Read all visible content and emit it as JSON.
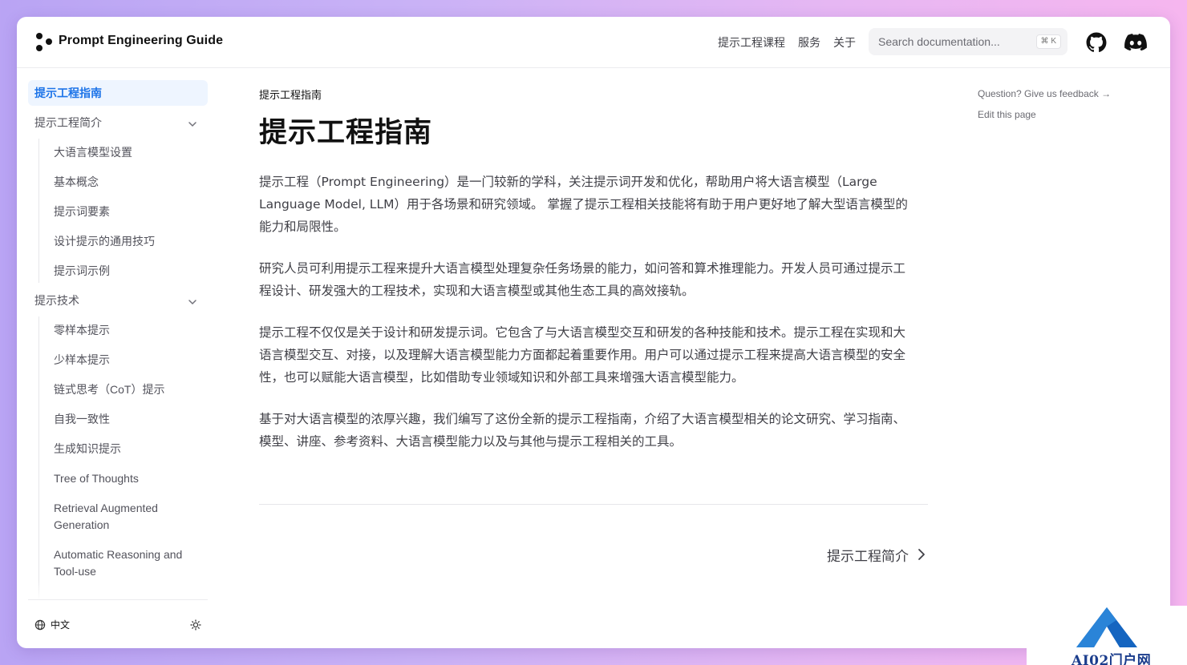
{
  "header": {
    "site_title": "Prompt Engineering Guide",
    "nav": [
      {
        "label": "提示工程课程"
      },
      {
        "label": "服务"
      },
      {
        "label": "关于"
      }
    ],
    "search": {
      "placeholder": "Search documentation...",
      "shortcut": "⌘ K"
    },
    "icons": [
      "github-icon",
      "discord-icon"
    ]
  },
  "sidebar": {
    "items": [
      {
        "label": "提示工程指南",
        "active": true,
        "level": 0
      },
      {
        "label": "提示工程简介",
        "level": 0,
        "expandable": true
      },
      {
        "label": "大语言模型设置",
        "level": 1
      },
      {
        "label": "基本概念",
        "level": 1
      },
      {
        "label": "提示词要素",
        "level": 1
      },
      {
        "label": "设计提示的通用技巧",
        "level": 1
      },
      {
        "label": "提示词示例",
        "level": 1
      },
      {
        "label": "提示技术",
        "level": 0,
        "expandable": true
      },
      {
        "label": "零样本提示",
        "level": 1
      },
      {
        "label": "少样本提示",
        "level": 1
      },
      {
        "label": "链式思考（CoT）提示",
        "level": 1
      },
      {
        "label": "自我一致性",
        "level": 1
      },
      {
        "label": "生成知识提示",
        "level": 1
      },
      {
        "label": "Tree of Thoughts",
        "level": 1
      },
      {
        "label": "Retrieval Augmented Generation",
        "level": 1,
        "lines": [
          "Retrieval Augmented",
          "Generation"
        ]
      },
      {
        "label": "Automatic Reasoning and Tool-use",
        "level": 1,
        "lines": [
          "Automatic Reasoning and",
          "Tool-use"
        ]
      }
    ],
    "footer": {
      "language": "中文",
      "theme_icon": "sun-icon"
    }
  },
  "main": {
    "breadcrumb": "提示工程指南",
    "title": "提示工程指南",
    "paragraphs": [
      [
        "提示工程（Prompt Engineering）是一门较新的学科，关注提示词开发和优化，帮助用户将大语言模型（Large",
        "Language Model, LLM）用于各场景和研究领域。 掌握了提示工程相关技能将有助于用户更好地了解大型语言模型的",
        "能力和局限性。"
      ],
      [
        "研究人员可利用提示工程来提升大语言模型处理复杂任务场景的能力，如问答和算术推理能力。开发人员可通过提示工",
        "程设计、研发强大的工程技术，实现和大语言模型或其他生态工具的高效接轨。"
      ],
      [
        "提示工程不仅仅是关于设计和研发提示词。它包含了与大语言模型交互和研发的各种技能和技术。提示工程在实现和大",
        "语言模型交互、对接，以及理解大语言模型能力方面都起着重要作用。用户可以通过提示工程来提高大语言模型的安全",
        "性，也可以赋能大语言模型，比如借助专业领域知识和外部工具来增强大语言模型能力。"
      ],
      [
        "基于对大语言模型的浓厚兴趣，我们编写了这份全新的提示工程指南，介绍了大语言模型相关的论文研究、学习指南、",
        "模型、讲座、参考资料、大语言模型能力以及与其他与提示工程相关的工具。"
      ]
    ],
    "next_link": "提示工程简介"
  },
  "toc": {
    "feedback": "Question? Give us feedback →",
    "edit": "Edit this page"
  },
  "watermark": {
    "text": "AI02门户网"
  },
  "colors": {
    "accent": "#1d74e8",
    "active_bg": "#eef5ff",
    "text": "#3f3f46"
  }
}
